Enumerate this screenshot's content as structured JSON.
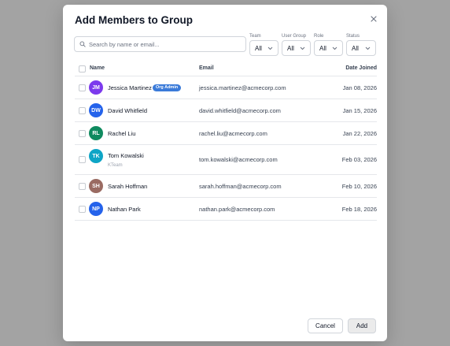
{
  "dialog": {
    "title": "Add Members to Group"
  },
  "search": {
    "placeholder": "Search by name or email..."
  },
  "filters": [
    {
      "label": "Team",
      "value": "All"
    },
    {
      "label": "User Group",
      "value": "All"
    },
    {
      "label": "Role",
      "value": "All"
    },
    {
      "label": "Status",
      "value": "All"
    }
  ],
  "table": {
    "columns": {
      "name": "Name",
      "email": "Email",
      "date": "Date Joined"
    },
    "rows": [
      {
        "initials": "JM",
        "avatar_color": "#7c3aed",
        "name": "Jessica Martinez",
        "badge": "Org Admin",
        "email": "jessica.martinez@acmecorp.com",
        "date": "Jan 08, 2026"
      },
      {
        "initials": "DW",
        "avatar_color": "#2563eb",
        "name": "David Whitfield",
        "email": "david.whitfield@acmecorp.com",
        "date": "Jan 15, 2026"
      },
      {
        "initials": "RL",
        "avatar_color": "#0f8a5f",
        "name": "Rachel Liu",
        "email": "rachel.liu@acmecorp.com",
        "date": "Jan 22, 2026"
      },
      {
        "initials": "TK",
        "avatar_color": "#0ea5c6",
        "name": "Tom Kowalski",
        "sub": "KTeam",
        "email": "tom.kowalski@acmecorp.com",
        "date": "Feb 03, 2026"
      },
      {
        "initials": "SH",
        "avatar_color": "#9a6b62",
        "name": "Sarah Hoffman",
        "email": "sarah.hoffman@acmecorp.com",
        "date": "Feb 10, 2026"
      },
      {
        "initials": "NP",
        "avatar_color": "#2563eb",
        "name": "Nathan Park",
        "email": "nathan.park@acmecorp.com",
        "date": "Feb 18, 2026"
      }
    ]
  },
  "footer": {
    "cancel_label": "Cancel",
    "add_label": "Add"
  },
  "icons": {
    "search": "search-icon",
    "close": "close-icon",
    "dropdown": "chevron-down-icon"
  }
}
